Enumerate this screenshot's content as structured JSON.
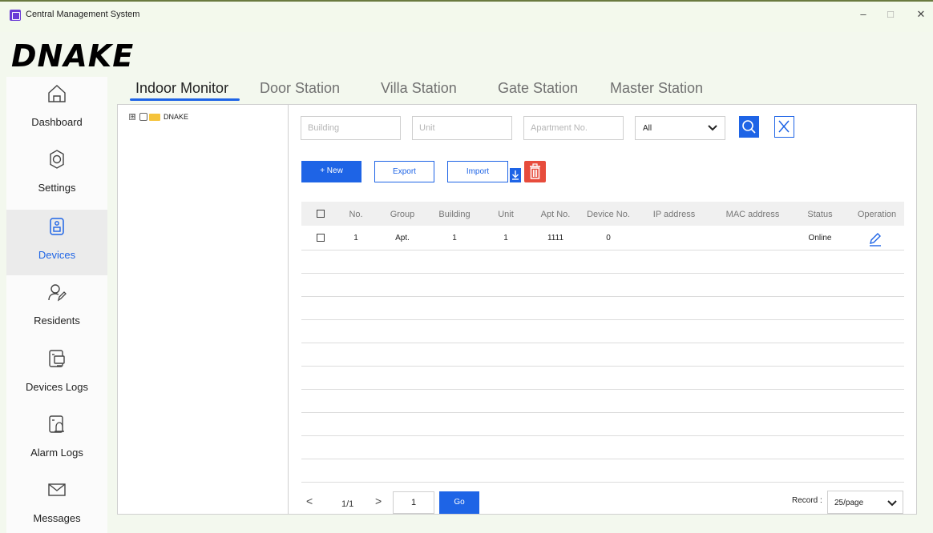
{
  "window": {
    "title": "Central Management System",
    "minimize": "–",
    "maximize": "□",
    "close": "✕"
  },
  "logo": "DNAKE",
  "sidebar": {
    "items": [
      {
        "label": "Dashboard",
        "icon": "home-icon"
      },
      {
        "label": "Settings",
        "icon": "gear-icon"
      },
      {
        "label": "Devices",
        "icon": "device-icon",
        "active": true
      },
      {
        "label": "Residents",
        "icon": "user-edit-icon"
      },
      {
        "label": "Devices Logs",
        "icon": "device-log-icon"
      },
      {
        "label": "Alarm Logs",
        "icon": "alarm-log-icon"
      },
      {
        "label": "Messages",
        "icon": "envelope-icon"
      }
    ]
  },
  "tabs": [
    {
      "label": "Indoor Monitor",
      "active": true
    },
    {
      "label": "Door Station"
    },
    {
      "label": "Villa Station"
    },
    {
      "label": "Gate Station"
    },
    {
      "label": "Master Station"
    }
  ],
  "tree": {
    "expand": "⊞",
    "root_label": "DNAKE"
  },
  "filters": {
    "building_placeholder": "Building",
    "unit_placeholder": "Unit",
    "apartment_placeholder": "Apartment No.",
    "status_select": "All"
  },
  "actions": {
    "new": "+ New",
    "export": "Export",
    "import": "Import"
  },
  "table": {
    "columns": [
      "No.",
      "Group",
      "Building",
      "Unit",
      "Apt No.",
      "Device No.",
      "IP address",
      "MAC address",
      "Status",
      "Operation"
    ],
    "rows": [
      {
        "no": "1",
        "group": "Apt.",
        "building": "1",
        "unit": "1",
        "apt_no": "1111",
        "device_no": "0",
        "ip": "",
        "mac": "",
        "status": "Online"
      }
    ]
  },
  "pagination": {
    "prev": "<",
    "page_info": "1/1",
    "next": ">",
    "page_input": "1",
    "go": "Go",
    "record_label": "Record :",
    "page_size": "25/page"
  },
  "colors": {
    "accent": "#1e64e6",
    "delete": "#e74c3c",
    "folder": "#f5c33b"
  }
}
